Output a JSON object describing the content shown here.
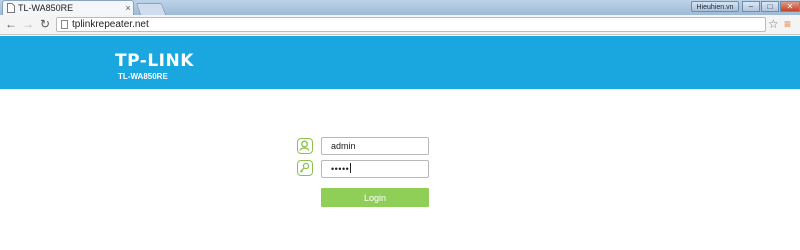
{
  "browser": {
    "tab_title": "TL-WA850RE",
    "tab_close": "×",
    "url": "tplinkrepeater.net",
    "user_badge": "Hieuhien.vn",
    "window_buttons": [
      "–",
      "□",
      "✕"
    ]
  },
  "header": {
    "brand": "TP-LINK",
    "model": "TL-WA850RE",
    "color": "#1aa7e0"
  },
  "login": {
    "username_value": "admin",
    "password_masked": "•••••",
    "login_label": "Login",
    "accent_color": "#8fcf57"
  },
  "icons": {
    "user": "user-icon",
    "password": "key-icon"
  }
}
